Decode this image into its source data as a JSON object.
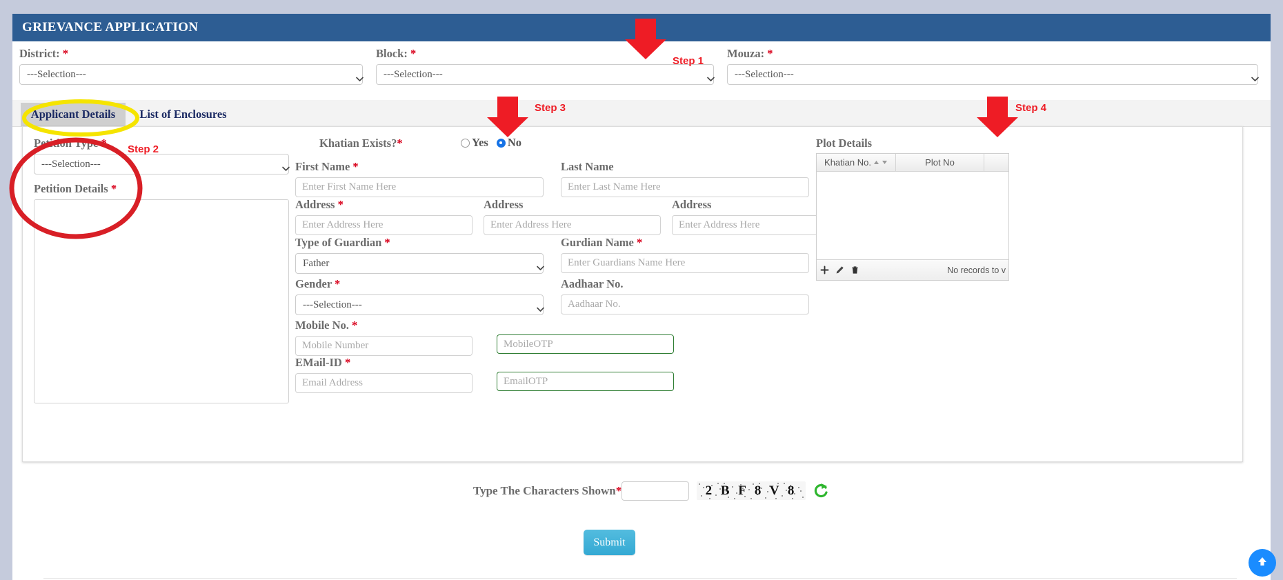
{
  "header": {
    "title": "GRIEVANCE APPLICATION"
  },
  "top_selects": [
    {
      "label": "District:",
      "required": "*",
      "value": "---Selection---"
    },
    {
      "label": "Block:",
      "required": "*",
      "value": "---Selection---"
    },
    {
      "label": "Mouza:",
      "required": "*",
      "value": "---Selection---"
    }
  ],
  "tabs": [
    {
      "label": "Applicant Details",
      "active": true
    },
    {
      "label": "List of Enclosures",
      "active": false
    }
  ],
  "left": {
    "petition_type": {
      "label": "Petition Type",
      "required": "*",
      "value": "---Selection---"
    },
    "petition_details": {
      "label": "Petition Details",
      "required": "*",
      "value": ""
    }
  },
  "khatian": {
    "label": "Khatian Exists?",
    "required": "*",
    "options": [
      {
        "label": "Yes",
        "selected": false
      },
      {
        "label": "No",
        "selected": true
      }
    ]
  },
  "fields": {
    "first_name": {
      "label": "First Name",
      "required": "*",
      "placeholder": "Enter First Name Here",
      "value": ""
    },
    "last_name": {
      "label": "Last Name",
      "required": "",
      "placeholder": "Enter Last Name Here",
      "value": ""
    },
    "address1": {
      "label": "Address",
      "required": "*",
      "placeholder": "Enter Address Here",
      "value": ""
    },
    "address2": {
      "label": "Address",
      "required": "",
      "placeholder": "Enter Address Here",
      "value": ""
    },
    "address3": {
      "label": "Address",
      "required": "",
      "placeholder": "Enter Address Here",
      "value": ""
    },
    "guardian_type": {
      "label": "Type of Guardian",
      "required": "*",
      "value": "Father"
    },
    "guardian_name": {
      "label": "Gurdian Name",
      "required": "*",
      "placeholder": "Enter Guardians Name Here",
      "value": ""
    },
    "gender": {
      "label": "Gender",
      "required": "*",
      "value": "---Selection---"
    },
    "aadhaar": {
      "label": "Aadhaar No.",
      "required": "",
      "placeholder": "Aadhaar No.",
      "value": ""
    },
    "mobile": {
      "label": "Mobile No.",
      "required": "*",
      "placeholder": "Mobile Number",
      "value": ""
    },
    "mobile_otp": {
      "label": "",
      "required": "",
      "placeholder": "MobileOTP",
      "value": ""
    },
    "email": {
      "label": "EMail-ID",
      "required": "*",
      "placeholder": "Email Address",
      "value": ""
    },
    "email_otp": {
      "label": "",
      "required": "",
      "placeholder": "EmailOTP",
      "value": ""
    }
  },
  "plot_details": {
    "title": "Plot Details",
    "columns": [
      "Khatian No.",
      "Plot No"
    ],
    "rows": [],
    "empty_message": "No records to v",
    "toolbar": [
      "add-icon",
      "edit-icon",
      "delete-icon"
    ]
  },
  "captcha": {
    "label": "Type The Characters Shown",
    "required": "*",
    "value": "",
    "image_text": "2 B F 8 V 8",
    "refresh_icon": "refresh-icon"
  },
  "submit": {
    "label": "Submit"
  },
  "annotations": [
    {
      "name": "step-1",
      "label": "Step 1"
    },
    {
      "name": "step-2",
      "label": "Step 2"
    },
    {
      "name": "step-3",
      "label": "Step 3"
    },
    {
      "name": "step-4",
      "label": "Step 4"
    }
  ],
  "scroll_top": {
    "icon": "arrow-up-icon"
  },
  "colors": {
    "header_blue": "#2d5d93",
    "annotation_red": "#ee1c25",
    "highlight_yellow": "#f5e400",
    "circle_red": "#d81f26",
    "submit_blue": "#34a9d3",
    "otp_green": "#2e7d32",
    "radio_blue": "#1673e6",
    "scroll_blue": "#1a8cff"
  }
}
